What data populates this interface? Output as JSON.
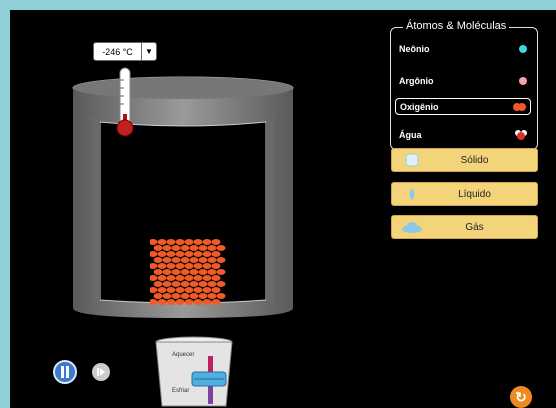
{
  "thermometer": {
    "value": "-246 °C",
    "dropdown_icon": "triangle-down"
  },
  "atoms_panel": {
    "title": "Átomos & Moléculas",
    "items": [
      {
        "label": "Neônio",
        "color": "#3fd6e0",
        "selected": false
      },
      {
        "label": "Argônio",
        "color": "#f4a0a8",
        "selected": false
      },
      {
        "label": "Oxigênio",
        "color": "#f05a28",
        "selected": true
      },
      {
        "label": "Água",
        "color": "#ffffff",
        "selected": false
      }
    ]
  },
  "phases": [
    {
      "label": "Sólido",
      "icon": "ice-cube-icon"
    },
    {
      "label": "Líquido",
      "icon": "droplet-icon"
    },
    {
      "label": "Gás",
      "icon": "cloud-icon"
    }
  ],
  "heater": {
    "heat_label": "Aquecer",
    "cool_label": "Esfriar"
  },
  "colors": {
    "background_frame": "#8fd0d8",
    "stage": "#000000",
    "button": "#f4d47a",
    "particle": "#f05a28"
  }
}
